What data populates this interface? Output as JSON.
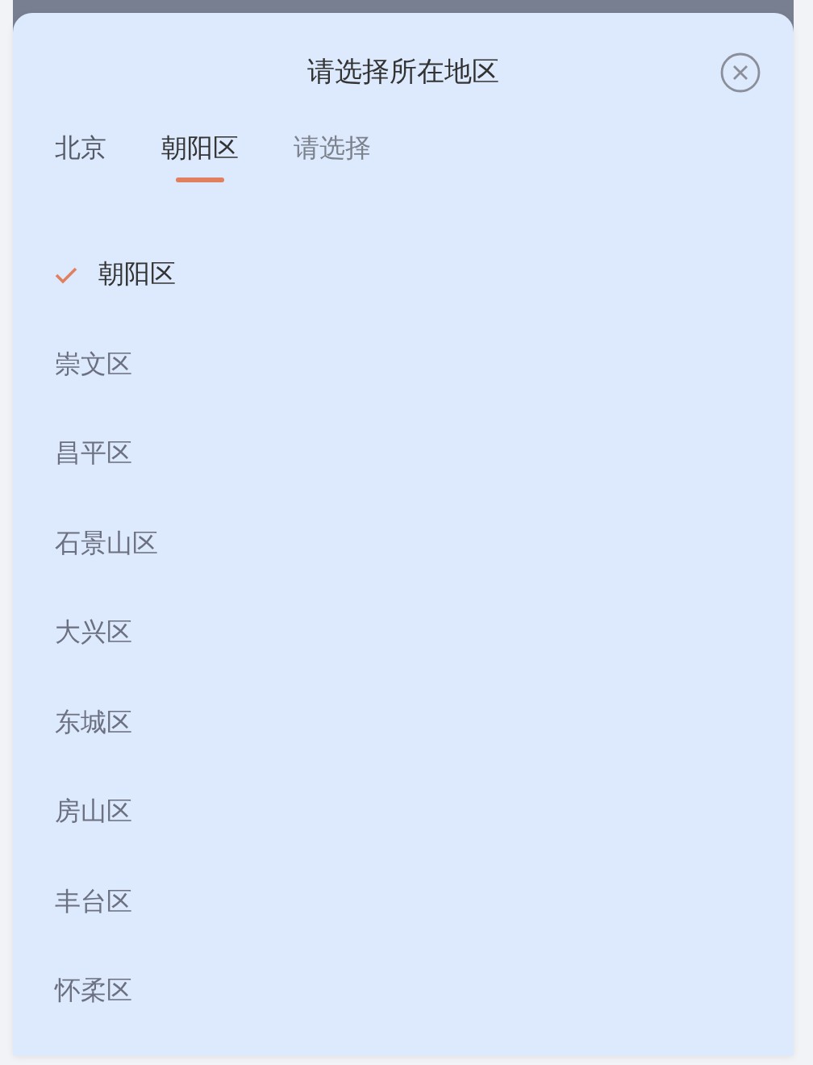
{
  "title": "请选择所在地区",
  "tabs": [
    {
      "label": "北京",
      "selected": false
    },
    {
      "label": "朝阳区",
      "selected": true
    },
    {
      "label": "请选择",
      "selected": false
    }
  ],
  "options": [
    {
      "label": "朝阳区",
      "selected": true
    },
    {
      "label": "崇文区",
      "selected": false
    },
    {
      "label": "昌平区",
      "selected": false
    },
    {
      "label": "石景山区",
      "selected": false
    },
    {
      "label": "大兴区",
      "selected": false
    },
    {
      "label": "东城区",
      "selected": false
    },
    {
      "label": "房山区",
      "selected": false
    },
    {
      "label": "丰台区",
      "selected": false
    },
    {
      "label": "怀柔区",
      "selected": false
    }
  ]
}
